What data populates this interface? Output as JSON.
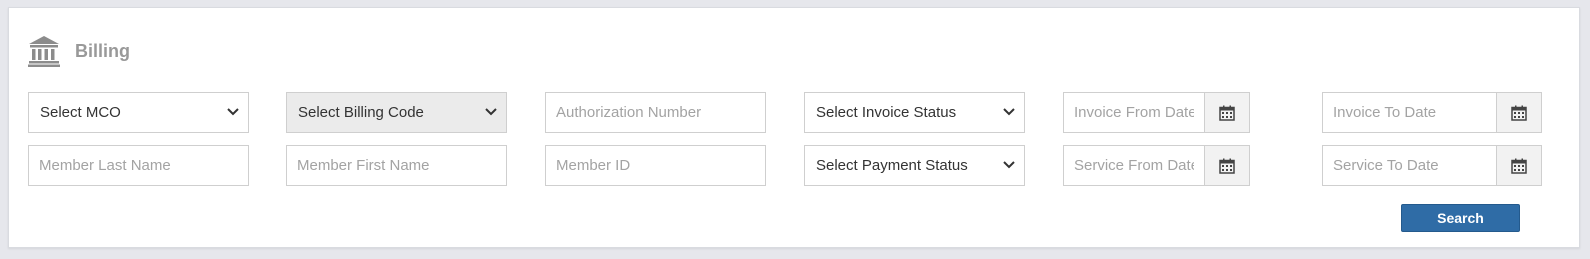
{
  "header": {
    "title": "Billing",
    "icon": "bank-icon"
  },
  "filters": {
    "mco_select": "Select MCO",
    "billing_code_select": "Select Billing Code",
    "authorization_number_placeholder": "Authorization Number",
    "invoice_status_select": "Select Invoice Status",
    "invoice_from_date_placeholder": "Invoice From Date",
    "invoice_to_date_placeholder": "Invoice To Date",
    "member_last_name_placeholder": "Member Last Name",
    "member_first_name_placeholder": "Member First Name",
    "member_id_placeholder": "Member ID",
    "payment_status_select": "Select Payment Status",
    "service_from_date_placeholder": "Service From Date",
    "service_to_date_placeholder": "Service To Date"
  },
  "actions": {
    "search_label": "Search"
  },
  "colors": {
    "primary_button": "#2f6ca6",
    "title_text": "#999999",
    "disabled_select": "#ebebeb"
  }
}
